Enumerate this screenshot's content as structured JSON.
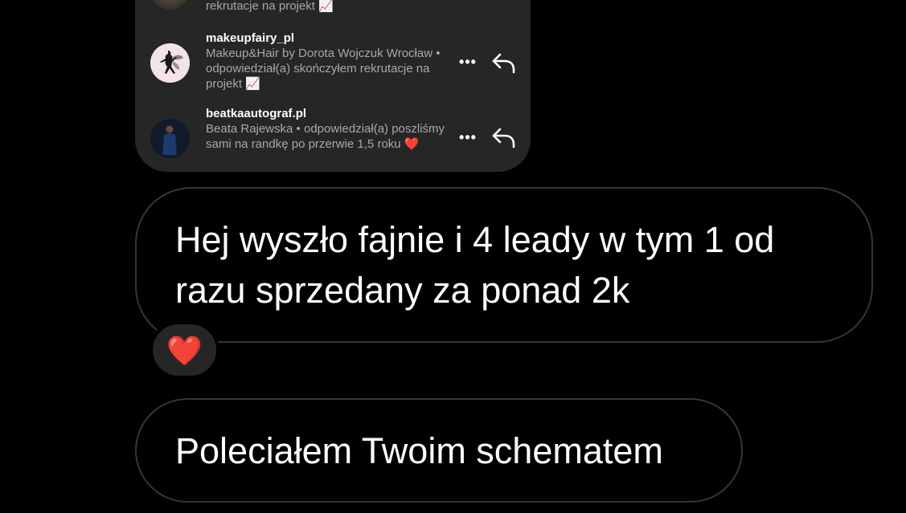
{
  "activity": {
    "rows": [
      {
        "username": "",
        "description": "rekrutacje na projekt 📈"
      },
      {
        "username": "makeupfairy_pl",
        "description": "Makeup&Hair by Dorota Wojczuk Wrocław • odpowiedział(a) skończyłem rekrutacje na projekt 📈"
      },
      {
        "username": "beatkaautograf.pl",
        "description": "Beata Rajewska • odpowiedział(a) poszliśmy sami na randkę po przerwie 1,5 roku ❤️"
      }
    ],
    "more_label": "•••"
  },
  "messages": [
    {
      "text": "Hej wyszło fajnie i 4 leady w tym 1 od razu sprzedany za ponad 2k"
    },
    {
      "text": "Poleciałem Twoim schematem"
    }
  ],
  "reaction": {
    "emoji": "❤️"
  },
  "colors": {
    "background": "#000000",
    "card": "#262626",
    "bubble_border": "#363636",
    "secondary_text": "#a8a8a8"
  }
}
